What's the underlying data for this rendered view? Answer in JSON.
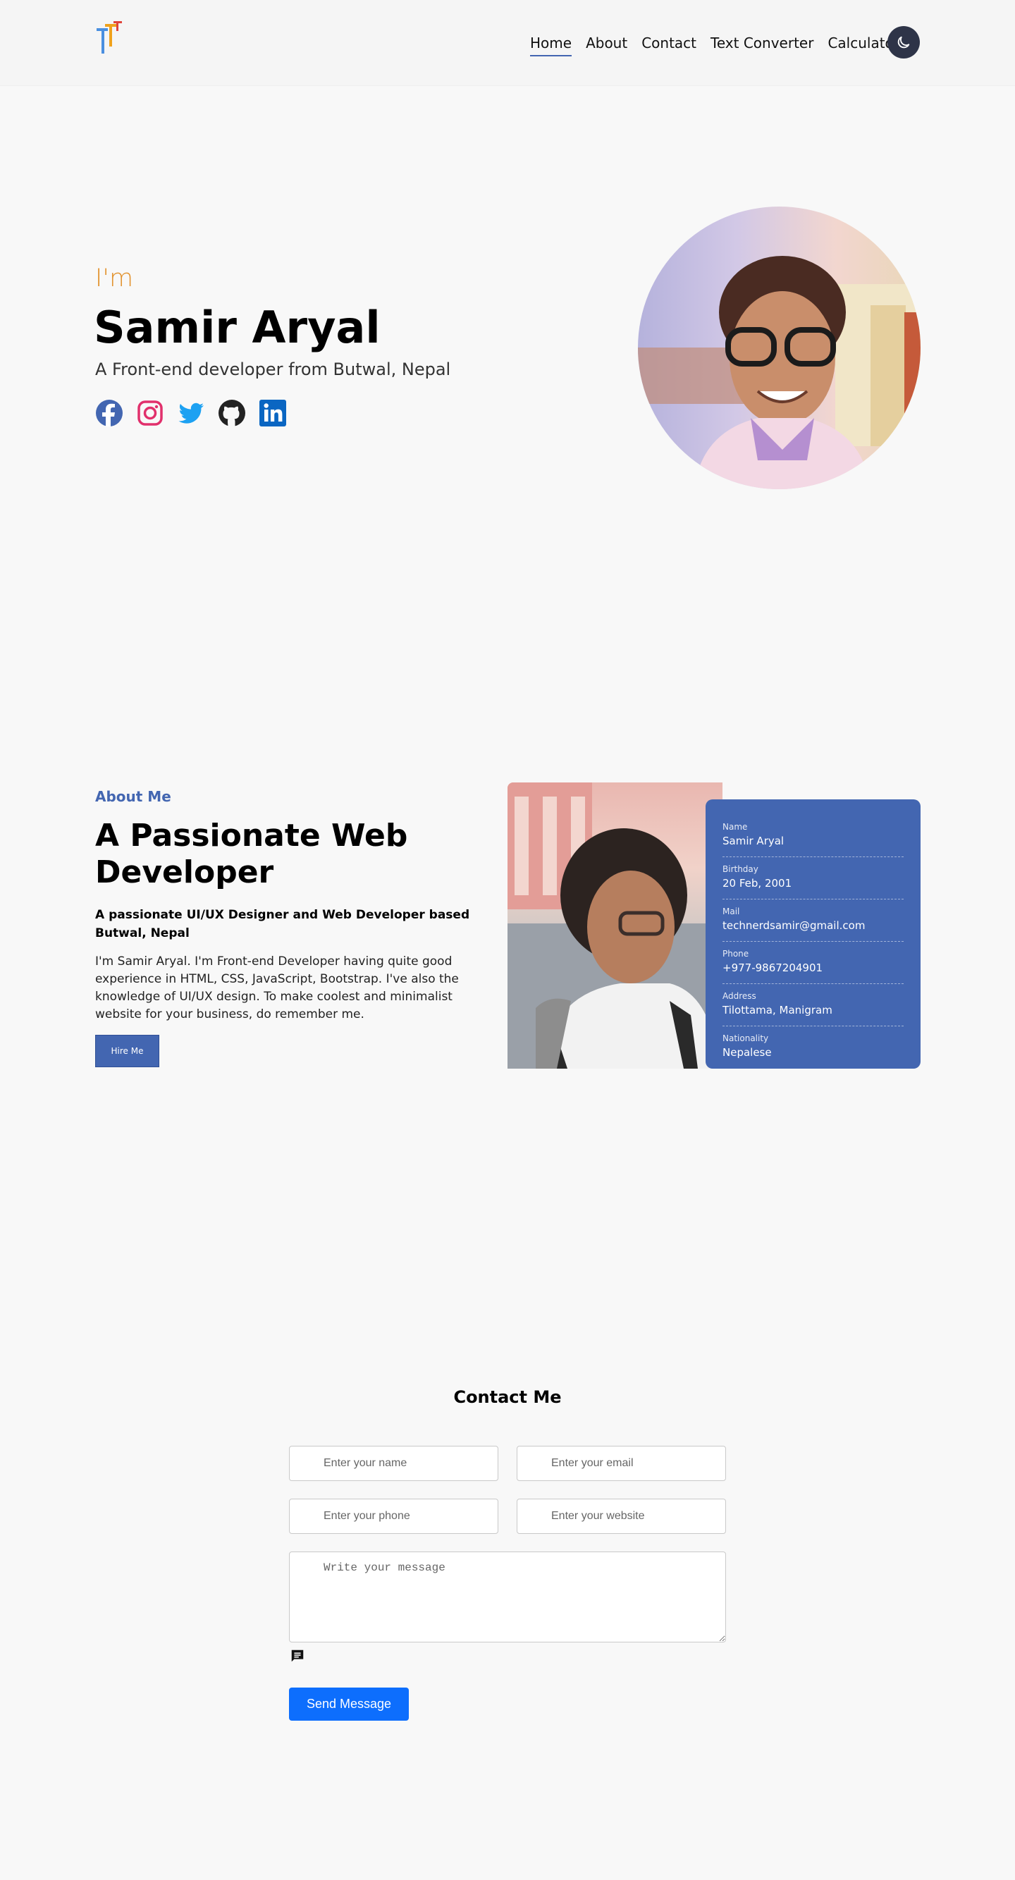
{
  "nav": {
    "items": [
      "Home",
      "About",
      "Contact",
      "Text Converter",
      "Calculator"
    ],
    "active_index": 0
  },
  "hero": {
    "greeting": "I'm",
    "name": "Samir Aryal",
    "subtitle": "A Front-end developer from Butwal, Nepal",
    "socials": [
      "facebook-icon",
      "instagram-icon",
      "twitter-icon",
      "github-icon",
      "linkedin-icon"
    ]
  },
  "about": {
    "kicker": "About Me",
    "title": "A Passionate Web Developer",
    "bold": "A passionate UI/UX Designer and Web Developer based Butwal, Nepal",
    "text": "I'm Samir Aryal. I'm Front-end Developer having quite good experience in HTML, CSS, JavaScript, Bootstrap. I've also the knowledge of UI/UX design. To make coolest and minimalist website for your business, do remember me.",
    "hire_label": "Hire Me",
    "info": [
      {
        "label": "Name",
        "value": "Samir Aryal"
      },
      {
        "label": "Birthday",
        "value": "20 Feb, 2001"
      },
      {
        "label": "Mail",
        "value": "technerdsamir@gmail.com"
      },
      {
        "label": "Phone",
        "value": "+977-9867204901"
      },
      {
        "label": "Address",
        "value": "Tilottama, Manigram"
      },
      {
        "label": "Nationality",
        "value": "Nepalese"
      }
    ]
  },
  "contact": {
    "title": "Contact Me",
    "name_placeholder": "Enter your name",
    "email_placeholder": "Enter your email",
    "phone_placeholder": "Enter your phone",
    "website_placeholder": "Enter your website",
    "message_placeholder": "Write your message",
    "send_label": "Send Message"
  },
  "colors": {
    "accent": "#4366b1",
    "greeting": "#e2922d",
    "send_button": "#0d6efd",
    "theme_button": "#2e3448"
  }
}
